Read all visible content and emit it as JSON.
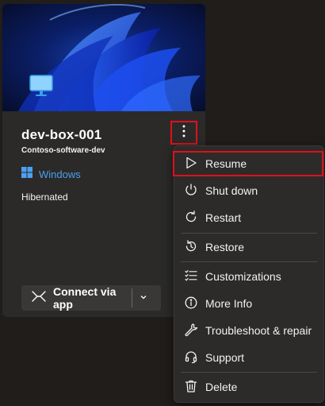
{
  "devbox": {
    "name": "dev-box-001",
    "project": "Contoso-software-dev",
    "os_label": "Windows",
    "status": "Hibernated",
    "connect_label": "Connect via app"
  },
  "menu": {
    "items": [
      {
        "label": "Resume",
        "icon": "play-icon"
      },
      {
        "label": "Shut down",
        "icon": "power-icon"
      },
      {
        "label": "Restart",
        "icon": "restart-icon"
      },
      {
        "label": "Restore",
        "icon": "restore-icon"
      },
      {
        "label": "Customizations",
        "icon": "checklist-icon"
      },
      {
        "label": "More Info",
        "icon": "info-icon"
      },
      {
        "label": "Troubleshoot & repair",
        "icon": "wrench-icon"
      },
      {
        "label": "Support",
        "icon": "headset-icon"
      },
      {
        "label": "Delete",
        "icon": "trash-icon"
      }
    ]
  },
  "colors": {
    "accent_red": "#e0101b",
    "link_blue": "#4ca0f0",
    "card_bg": "#2b2a29",
    "page_bg": "#201d1b"
  }
}
